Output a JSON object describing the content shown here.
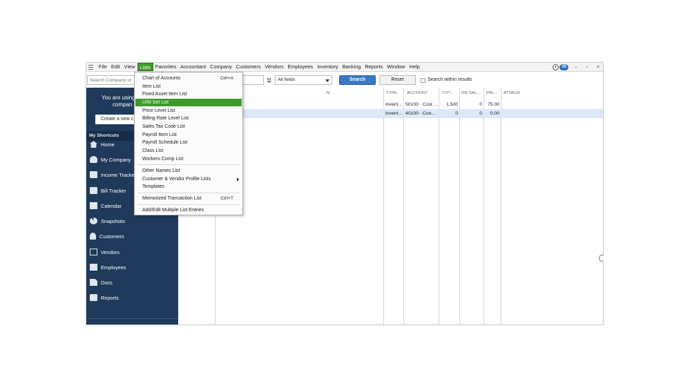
{
  "menubar": {
    "items": [
      "File",
      "Edit",
      "View",
      "Lists",
      "Favorites",
      "Accountant",
      "Company",
      "Customers",
      "Vendors",
      "Employees",
      "Inventory",
      "Banking",
      "Reports",
      "Window",
      "Help"
    ],
    "active_item": "Lists",
    "notification_count": "35",
    "window_controls": [
      "–",
      "▫",
      "×"
    ]
  },
  "search": {
    "company_placeholder": "Search Company or",
    "in_label": "in",
    "scope_value": "All fields",
    "search_button": "Search",
    "reset_button": "Reset",
    "within_label": "Search within results"
  },
  "sidebar": {
    "promo_line1": "You are using",
    "promo_line2": "compan",
    "create_button": "Create a new c",
    "shortcuts_header": "My Shortcuts",
    "items": [
      "Home",
      "My Company",
      "Income Tracker",
      "Bill Tracker",
      "Calendar",
      "Snapshots",
      "Customers",
      "Vendors",
      "Employees",
      "Docs",
      "Reports"
    ]
  },
  "table": {
    "headers": {
      "description": "N",
      "type": "TYPE",
      "account": "ACCOUNT",
      "total": "TOT...",
      "on_sales": "ON SAL...",
      "price": "PRI...",
      "attach": "ATTACH"
    },
    "rows": [
      {
        "type": "Invent...",
        "account": "50100 · Cost ...",
        "total": "1,500",
        "on_sales": "0",
        "price": "75.00"
      },
      {
        "type": "Invent...",
        "account": "40100 · Con...",
        "total": "0",
        "on_sales": "0",
        "price": "0.00"
      }
    ]
  },
  "lists_menu": {
    "items": [
      {
        "label": "Chart of Accounts",
        "shortcut": "Ctrl+A"
      },
      {
        "label": "Item List",
        "shortcut": ""
      },
      {
        "label": "Fixed Asset Item List",
        "shortcut": ""
      },
      {
        "label": "U/M Set List",
        "shortcut": ""
      },
      {
        "label": "Price Level List",
        "shortcut": ""
      },
      {
        "label": "Billing Rate Level List",
        "shortcut": ""
      },
      {
        "label": "Sales Tax Code List",
        "shortcut": ""
      },
      {
        "label": "Payroll Item List",
        "shortcut": ""
      },
      {
        "label": "Payroll Schedule List",
        "shortcut": ""
      },
      {
        "label": "Class List",
        "shortcut": ""
      },
      {
        "label": "Workers Comp List",
        "shortcut": ""
      },
      {
        "label": "Other Names List",
        "shortcut": ""
      },
      {
        "label": "Customer & Vendor Profile Lists",
        "shortcut": ""
      },
      {
        "label": "Templates",
        "shortcut": ""
      },
      {
        "label": "Memorized Transaction List",
        "shortcut": "Ctrl+T"
      },
      {
        "label": "Add/Edit Multiple List Entries",
        "shortcut": ""
      }
    ],
    "highlighted_item": "U/M Set List"
  },
  "colors": {
    "accent_green": "#3d9a2a",
    "sidebar_navy": "#1f3a5a",
    "search_blue": "#3b78c4",
    "selected_row": "#dbe8f7"
  }
}
